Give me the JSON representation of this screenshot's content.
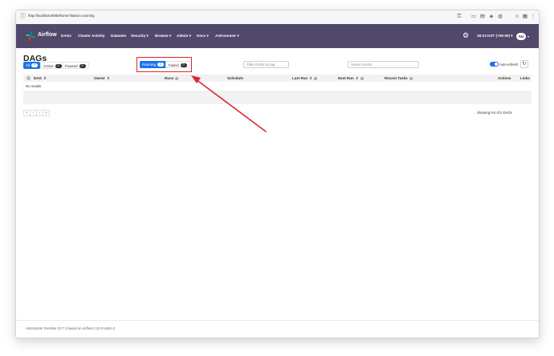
{
  "browser": {
    "url": "http://localhost:8080/home?lastrun=running"
  },
  "navbar": {
    "brand": "Airflow",
    "items": [
      "DAGs",
      "Cluster Activity",
      "Datasets",
      "Security",
      "Browse",
      "Admin",
      "Docs",
      "Astronomer"
    ],
    "time": "18:23 KST (+09:00)",
    "user_initials": "AU"
  },
  "page": {
    "title": "DAGs"
  },
  "filters": {
    "status": [
      {
        "label": "All",
        "count": "0"
      },
      {
        "label": "Active",
        "count": "0"
      },
      {
        "label": "Paused",
        "count": "0"
      }
    ],
    "lastrun": [
      {
        "label": "Running",
        "count": "0"
      },
      {
        "label": "Failed",
        "count": "0"
      }
    ],
    "tag_placeholder": "Filter DAGs by tag",
    "search_placeholder": "Search DAGs",
    "auto_refresh_label": "Auto-refresh"
  },
  "table": {
    "columns": [
      "DAG",
      "Owner",
      "Runs",
      "Schedule",
      "Last Run",
      "Next Run",
      "Recent Tasks",
      "Actions",
      "Links"
    ],
    "empty_message": "No results",
    "showing": "Showing 0-0 of 0 DAGs"
  },
  "pager": [
    "«",
    "‹",
    "›",
    "»"
  ],
  "footer": "Astronomer Runtime 10.7.1 based on Airflow 2.10.0+astro.2",
  "colors": {
    "navbar": "#51486b",
    "accent": "#1c73e8",
    "annotation": "#d9282f"
  }
}
